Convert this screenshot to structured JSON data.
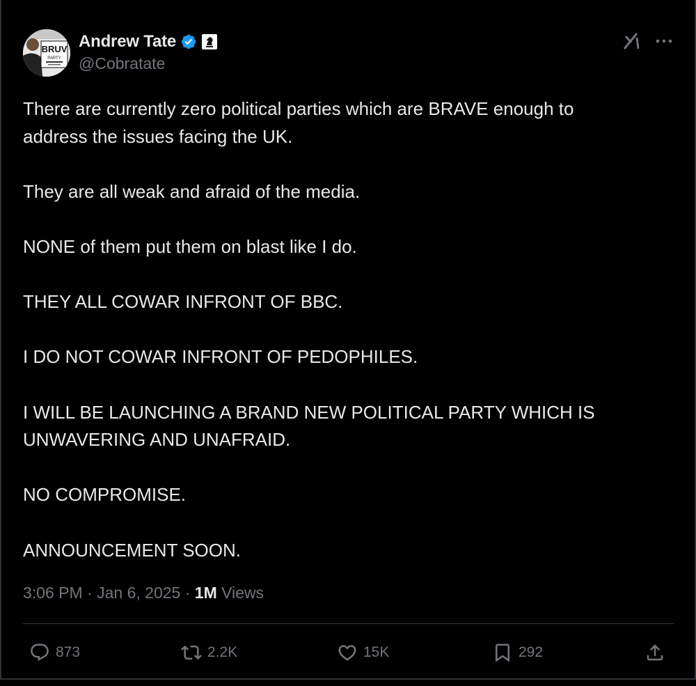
{
  "author": {
    "display_name": "Andrew Tate",
    "handle": "@Cobratate",
    "verified": true,
    "avatar_text": "BRUV PARTY"
  },
  "tweet": {
    "paragraphs": [
      "There are currently zero political parties which are BRAVE enough to\naddress the issues facing the UK.",
      "They are all weak and afraid of the media.",
      "NONE of them put them on blast like I do.",
      "THEY ALL COWAR INFRONT OF BBC.",
      "I DO NOT COWAR INFRONT OF PEDOPHILES.",
      "I WILL BE LAUNCHING A BRAND NEW POLITICAL PARTY WHICH IS\nUNWAVERING AND UNAFRAID.",
      "NO COMPROMISE.",
      "ANNOUNCEMENT SOON."
    ],
    "time": "3:06 PM",
    "date": "Jan 6, 2025",
    "views_count": "1M",
    "views_label": "Views"
  },
  "actions": {
    "replies": "873",
    "reposts": "2.2K",
    "likes": "15K",
    "bookmarks": "292"
  },
  "icons": {
    "verified": "verified-badge-icon",
    "affiliate": "chess-knight-badge-icon",
    "grok": "grok-icon",
    "more": "more-dots-icon",
    "reply": "reply-icon",
    "repost": "repost-icon",
    "like": "heart-icon",
    "bookmark": "bookmark-icon",
    "share": "share-icon"
  },
  "colors": {
    "background": "#000000",
    "text": "#e7e9ea",
    "secondary": "#71767b",
    "verified_blue": "#1d9bf0",
    "divider": "#2f3336"
  }
}
